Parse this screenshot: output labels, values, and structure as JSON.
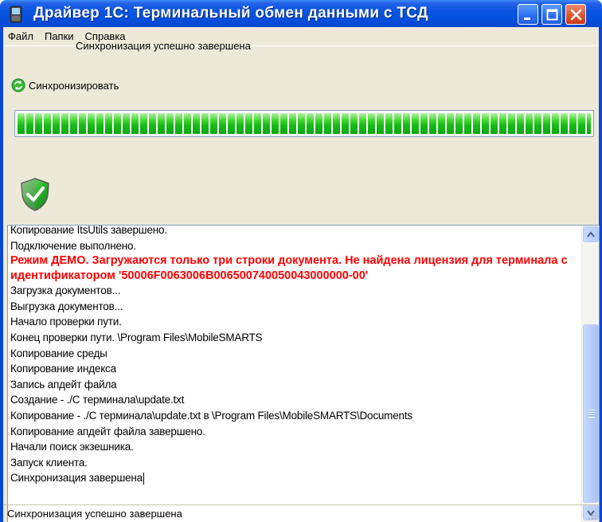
{
  "window": {
    "title": "Драйвер 1С: Терминальный обмен данными с ТСД"
  },
  "menu": {
    "items": [
      "Файл",
      "Папки",
      "Справка"
    ]
  },
  "toolbar": {
    "sync_label": "Синхронизировать"
  },
  "progress": {
    "percent": 100,
    "color": "#2ccf2c"
  },
  "status": {
    "message": "Синхронизация успешно завершена"
  },
  "log": {
    "lines": [
      {
        "text": "Копирование ItsUtils завершено.",
        "type": "normal"
      },
      {
        "text": "Подключение выполнено.",
        "type": "normal"
      },
      {
        "text": "Режим ДЕМО. Загружаются только три строки документа. Не найдена лицензия для терминала с идентификатором '50006F0063006B006500740050043000000-00'",
        "type": "warning"
      },
      {
        "text": "Загрузка документов...",
        "type": "normal"
      },
      {
        "text": "Выгрузка документов...",
        "type": "normal"
      },
      {
        "text": "Начало проверки пути.",
        "type": "normal"
      },
      {
        "text": "Конец проверки пути. \\Program Files\\MobileSMARTS",
        "type": "normal"
      },
      {
        "text": "Копирование среды",
        "type": "normal"
      },
      {
        "text": "Копирование индекса",
        "type": "normal"
      },
      {
        "text": "Запись апдейт файла",
        "type": "normal"
      },
      {
        "text": "Создание - ./С терминала\\update.txt",
        "type": "normal"
      },
      {
        "text": "Копирование - ./С терминала\\update.txt в \\Program Files\\MobileSMARTS\\Documents",
        "type": "normal"
      },
      {
        "text": "Копирование апдейт файла завершено.",
        "type": "normal"
      },
      {
        "text": "Начали поиск экзешника.",
        "type": "normal"
      },
      {
        "text": "Запуск клиента.",
        "type": "normal"
      },
      {
        "text": "Синхронизация завершена",
        "type": "normal"
      }
    ],
    "warning_color": "#ff0000"
  },
  "statusbar": {
    "text": "Синхронизация успешно завершена"
  },
  "icons": {
    "app": "pda-device-icon",
    "sync": "sync-icon",
    "status": "shield-check-icon"
  }
}
